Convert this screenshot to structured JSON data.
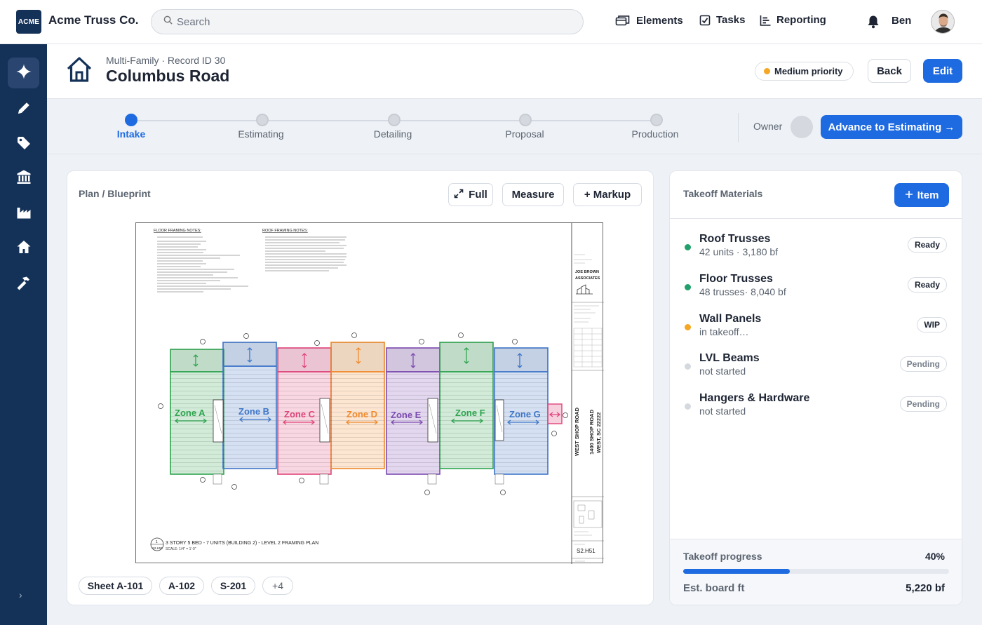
{
  "topbar": {
    "logo_text": "ACME",
    "app_name": "Acme Truss Co.",
    "search_placeholder": "Search",
    "nav": [
      {
        "label": "Elements",
        "icon": "cards-icon"
      },
      {
        "label": "Tasks",
        "icon": "checkbox-icon"
      },
      {
        "label": "Reporting",
        "icon": "report-icon"
      }
    ],
    "user_name": "Ben"
  },
  "sidebar": {
    "items": [
      {
        "icon": "sparkle-icon",
        "active": true
      },
      {
        "icon": "pencil-icon",
        "active": false
      },
      {
        "icon": "tag-icon",
        "active": false
      },
      {
        "icon": "bank-icon",
        "active": false
      },
      {
        "icon": "factory-icon",
        "active": false
      },
      {
        "icon": "home-icon",
        "active": false
      },
      {
        "icon": "hammer-icon",
        "active": false
      }
    ],
    "collapse_glyph": "›"
  },
  "record": {
    "meta": "Multi-Family · Record ID 30",
    "title": "Columbus Road",
    "priority": "Medium priority",
    "priority_color": "#f5a623",
    "back_label": "Back",
    "edit_label": "Edit"
  },
  "stepper": {
    "steps": [
      "Intake",
      "Estimating",
      "Detailing",
      "Proposal",
      "Production"
    ],
    "active_index": 0,
    "owner_label": "Owner",
    "advance_label": "Advance to Estimating →"
  },
  "plan": {
    "title": "Plan / Blueprint",
    "full_label": "Full",
    "measure_label": "Measure",
    "markup_label": "+ Markup",
    "blueprint": {
      "floor_notes_title": "FLOOR FRAMING NOTES:",
      "roof_notes_title": "ROOF FRAMING NOTES:",
      "zones": [
        {
          "label": "Zone A",
          "color": "#2fa44f"
        },
        {
          "label": "Zone B",
          "color": "#3f76c8"
        },
        {
          "label": "Zone C",
          "color": "#e0447a"
        },
        {
          "label": "Zone D",
          "color": "#f08a2c"
        },
        {
          "label": "Zone E",
          "color": "#7c4bb0"
        },
        {
          "label": "Zone F",
          "color": "#2fa44f"
        },
        {
          "label": "Zone G",
          "color": "#3f76c8"
        }
      ],
      "firm": "JOE BROWN ASSOCIATES",
      "project_name": "WEST SHOP ROAD",
      "project_address": "1400 SHOP ROAD",
      "project_city": "WEST, SC 22222",
      "sheet_number": "S2.H51",
      "caption": "3 STORY 5 BED - 7 UNITS (BUILDING 2) - LEVEL 2 FRAMING PLAN",
      "scale": "SCALE: 1/4\" = 1'-0\"",
      "callout_num": "1",
      "callout_sheet": "S2.H51"
    },
    "sheets": [
      "Sheet A-101",
      "A-102",
      "S-201",
      "+4"
    ]
  },
  "takeoff": {
    "title": "Takeoff Materials",
    "add_label": "Item",
    "materials": [
      {
        "name": "Roof Trusses",
        "sub": "42 units · 3,180 bf",
        "status": "Ready",
        "dot": "#22a06b"
      },
      {
        "name": "Floor Trusses",
        "sub": "48 trusses· 8,040 bf",
        "status": "Ready",
        "dot": "#22a06b"
      },
      {
        "name": "Wall Panels",
        "sub": "in takeoff…",
        "status": "WIP",
        "dot": "#f5a623"
      },
      {
        "name": "LVL Beams",
        "sub": "not started",
        "status": "Pending",
        "dot": "#d5d9df"
      },
      {
        "name": "Hangers & Hardware",
        "sub": "not started",
        "status": "Pending",
        "dot": "#d5d9df"
      }
    ],
    "progress_label": "Takeoff progress",
    "progress_text": "40%",
    "progress_value": 0.4,
    "board_label": "Est. board ft",
    "board_value": "5,220 bf"
  },
  "colors": {
    "navy": "#143158",
    "accent": "#1e6ae0"
  }
}
